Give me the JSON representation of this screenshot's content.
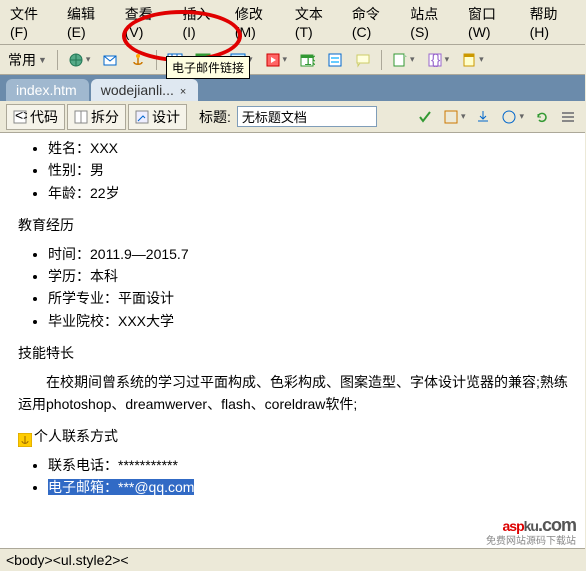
{
  "menu": [
    "文件(F)",
    "编辑(E)",
    "查看(V)",
    "插入(I)",
    "修改(M)",
    "文本(T)",
    "命令(C)",
    "站点(S)",
    "窗口(W)",
    "帮助(H)"
  ],
  "toolbar1": {
    "label": "常用"
  },
  "tooltip": "电子邮件链接",
  "tabs": [
    {
      "label": "index.htm",
      "active": false
    },
    {
      "label": "wodejianli...",
      "active": true
    }
  ],
  "viewbar": {
    "code": "代码",
    "split": "拆分",
    "design": "设计",
    "titlelbl": "标题:",
    "titleval": "无标题文档"
  },
  "doc": {
    "info": [
      "姓名：XXX",
      "性别：男",
      "年龄：22岁"
    ],
    "edu_h": "教育经历",
    "edu": [
      "时间：2011.9—2015.7",
      "学历：本科",
      "所学专业：平面设计",
      "毕业院校：XXX大学"
    ],
    "skill_h": "技能特长",
    "skill_p": "　　在校期间曾系统的学习过平面构成、色彩构成、图案造型、字体设计览器的兼容;熟练运用photoshop、dreamwerver、flash、coreldraw软件;",
    "contact_h": "个人联系方式",
    "contact": [
      "联系电话：***********"
    ],
    "contact_hl": "电子邮箱：***@qq.com"
  },
  "status": "<body><ul.style2><",
  "wm": {
    "a": "asp",
    "b": "ku",
    "c": ".com",
    "sub": "免费网站源码下载站"
  }
}
